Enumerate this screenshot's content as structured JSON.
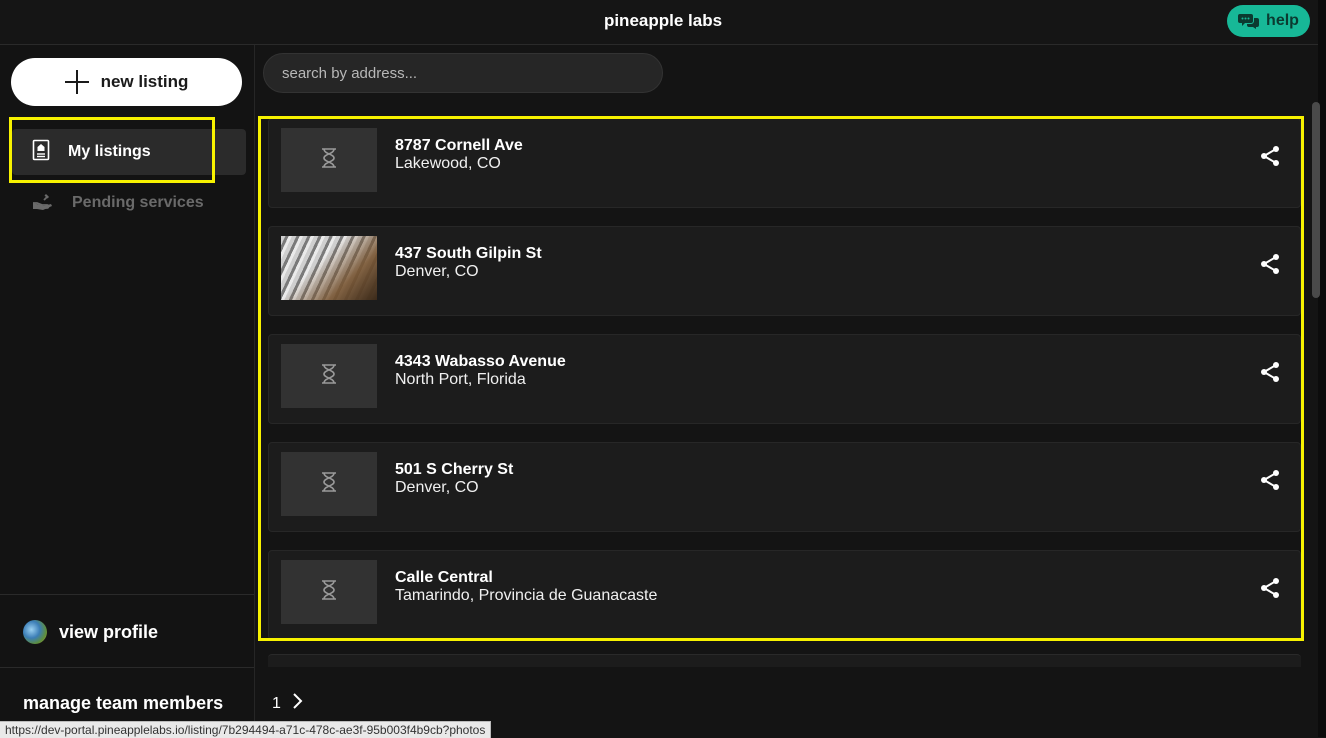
{
  "header": {
    "title": "pineapple labs",
    "help_label": "help"
  },
  "sidebar": {
    "new_listing_label": "new listing",
    "items": [
      {
        "label": "My listings",
        "icon": "listing-doc-icon",
        "active": true
      },
      {
        "label": "Pending services",
        "icon": "hand-service-icon",
        "active": false
      }
    ],
    "profile_label": "view profile",
    "team_label": "manage team members"
  },
  "search": {
    "placeholder": "search by address..."
  },
  "listings": [
    {
      "address": "8787 Cornell Ave",
      "city": "Lakewood, CO",
      "thumb": "hourglass-icon"
    },
    {
      "address": "437 South Gilpin St",
      "city": "Denver, CO",
      "thumb": "photo"
    },
    {
      "address": "4343 Wabasso Avenue",
      "city": "North Port, Florida",
      "thumb": "hourglass-icon"
    },
    {
      "address": "501 S Cherry St",
      "city": "Denver, CO",
      "thumb": "hourglass-icon"
    },
    {
      "address": "Calle Central",
      "city": "Tamarindo, Provincia de Guanacaste",
      "thumb": "hourglass-icon"
    }
  ],
  "pagination": {
    "current_page": "1"
  },
  "status_bar": {
    "url": "https://dev-portal.pineapplelabs.io/listing/7b294494-a71c-478c-ae3f-95b003f4b9cb?photos"
  },
  "colors": {
    "accent": "#17b897",
    "highlight": "#f7f200",
    "background": "#141414"
  }
}
